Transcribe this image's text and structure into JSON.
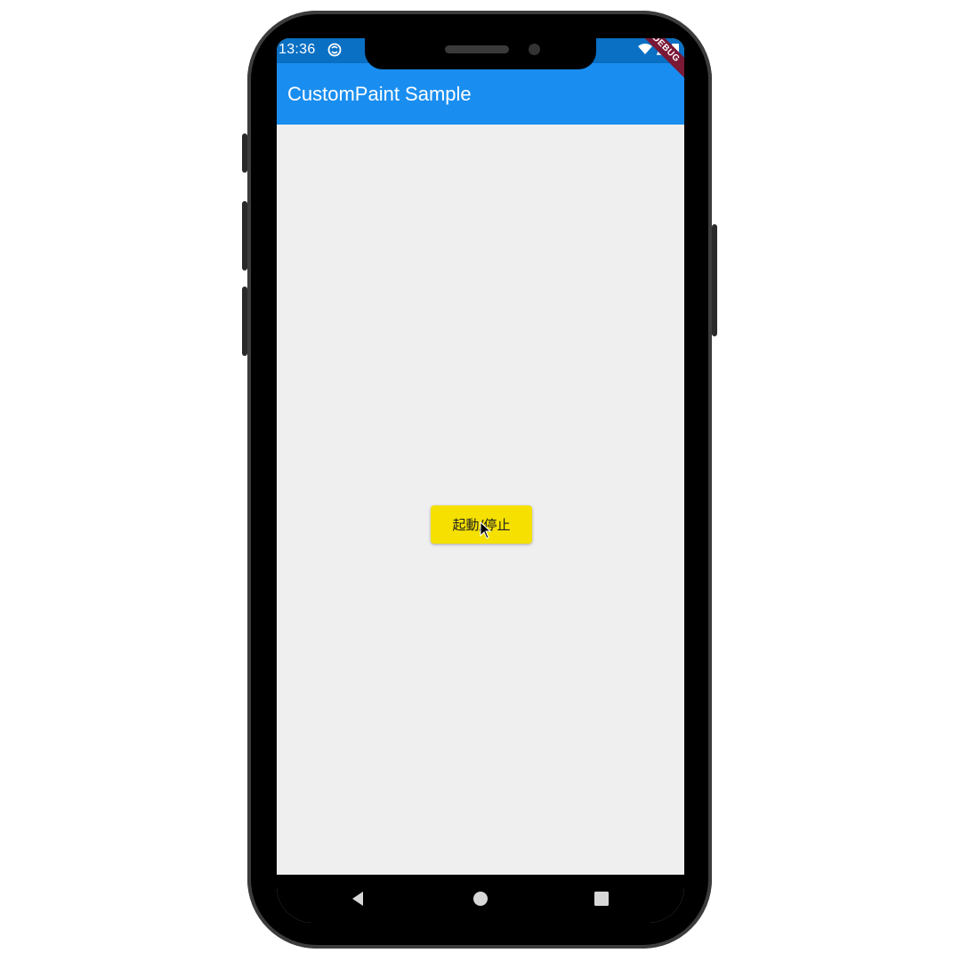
{
  "status_bar": {
    "time": "13:36",
    "app_icon": "app-status-icon",
    "right_icons": [
      "wifi-icon",
      "signal-icon",
      "battery-icon"
    ]
  },
  "app_bar": {
    "title": "CustomPaint Sample",
    "color": "#1a8ef0"
  },
  "debug_banner": {
    "label": "DEBUG",
    "color": "#7a1836"
  },
  "main": {
    "toggle_button_label": "起動/停止",
    "toggle_button_color": "#f5e000"
  },
  "nav_bar": {
    "buttons": [
      "back-icon",
      "home-icon",
      "recents-icon"
    ]
  }
}
